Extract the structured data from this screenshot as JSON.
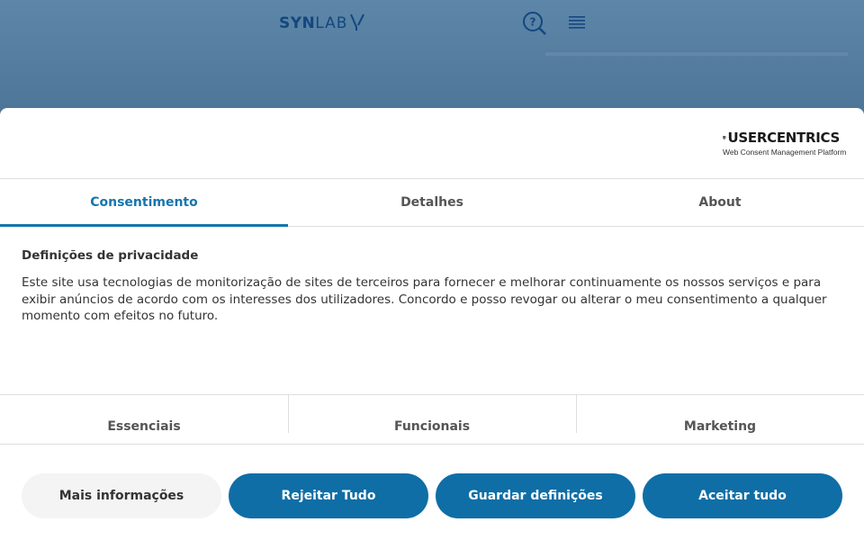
{
  "site": {
    "logo_primary": "SYN",
    "logo_secondary": "LAB"
  },
  "consent_banner": {
    "brand_name": "USERCENTRICS",
    "brand_tagline": "Web Consent Management Platform",
    "tabs": [
      {
        "label": "Consentimento",
        "active": true
      },
      {
        "label": "Detalhes",
        "active": false
      },
      {
        "label": "About",
        "active": false
      }
    ],
    "heading": "Definições de privacidade",
    "description": "Este site usa tecnologias de monitorização de sites de terceiros para fornecer e melhorar continuamente os nossos serviços e para exibir anúncios de acordo com os interesses dos utilizadores. Concordo e posso revogar ou alterar o meu consentimento a qualquer momento com efeitos no futuro.",
    "categories": [
      "Essenciais",
      "Funcionais",
      "Marketing"
    ],
    "buttons": {
      "more_info": "Mais informações",
      "reject_all": "Rejeitar Tudo",
      "save_settings": "Guardar definições",
      "accept_all": "Aceitar tudo"
    },
    "colors": {
      "accent": "#1675ae",
      "primary_button": "#0f6ea6",
      "secondary_button": "#f4f4f4"
    }
  }
}
